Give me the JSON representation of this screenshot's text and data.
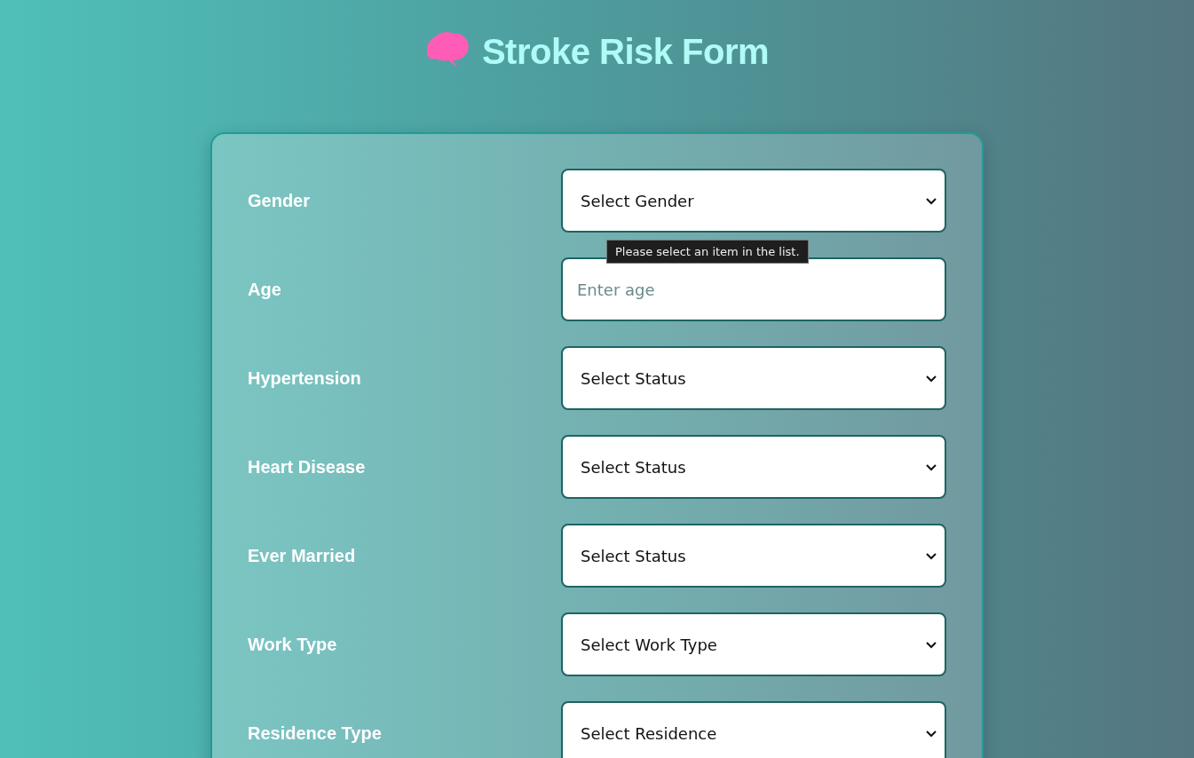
{
  "title": "Stroke Risk Form",
  "fields": [
    {
      "label": "Gender",
      "kind": "select",
      "value": "Select Gender",
      "tooltip": "Please select an item in the list."
    },
    {
      "label": "Age",
      "kind": "input",
      "placeholder": "Enter age"
    },
    {
      "label": "Hypertension",
      "kind": "select",
      "value": "Select Status"
    },
    {
      "label": "Heart Disease",
      "kind": "select",
      "value": "Select Status"
    },
    {
      "label": "Ever Married",
      "kind": "select",
      "value": "Select Status"
    },
    {
      "label": "Work Type",
      "kind": "select",
      "value": "Select Work Type"
    },
    {
      "label": "Residence Type",
      "kind": "select",
      "value": "Select Residence"
    }
  ]
}
